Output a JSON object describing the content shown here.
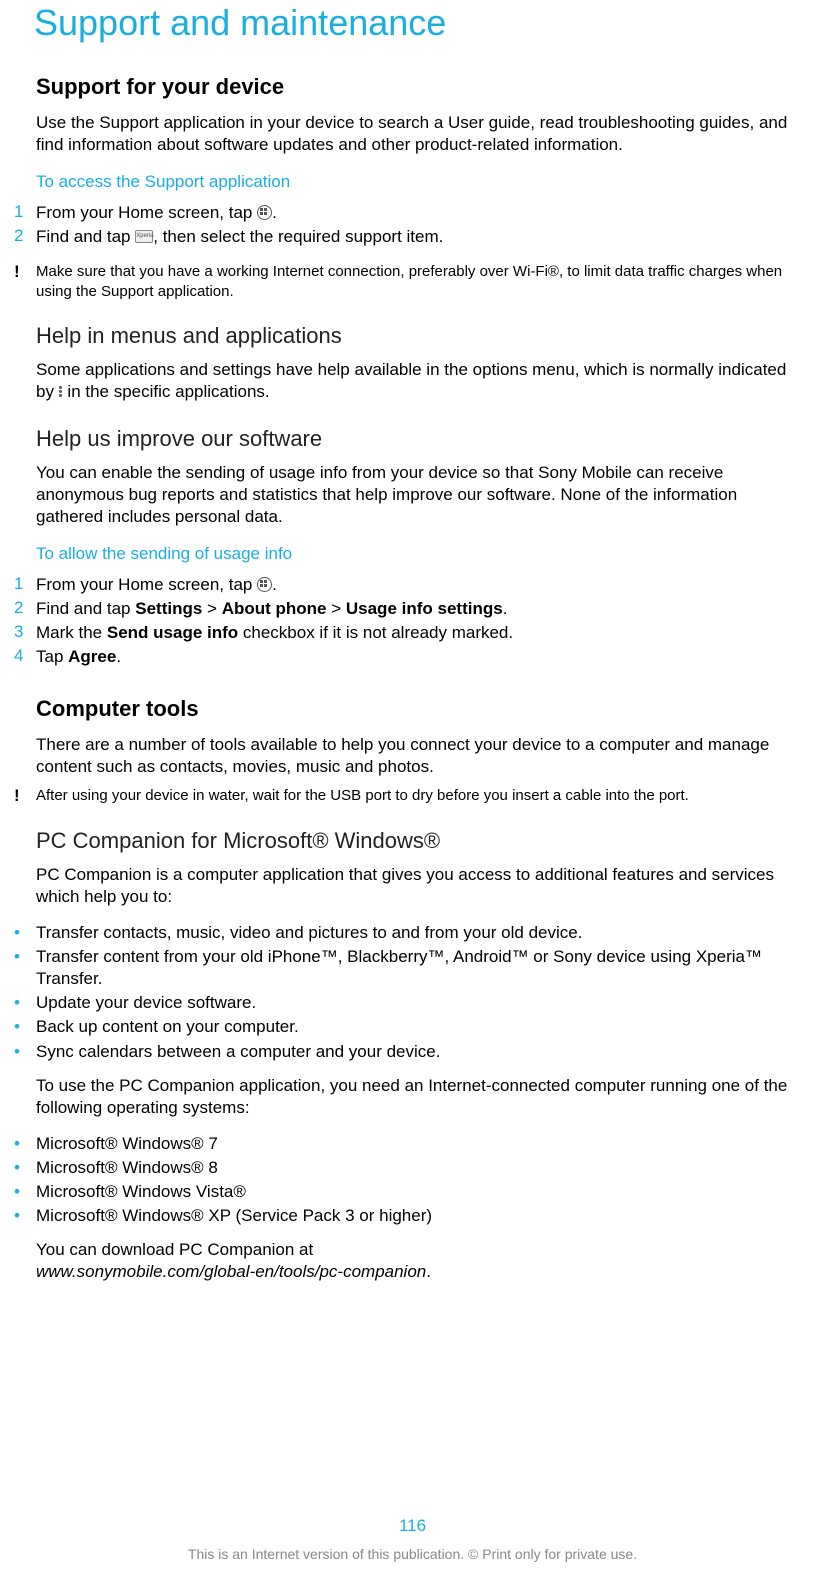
{
  "page_title": "Support and maintenance",
  "support_device": {
    "heading": "Support for your device",
    "body": "Use the Support application in your device to search a User guide, read troubleshooting guides, and find information about software updates and other product-related information.",
    "sub_cyan": "To access the Support application",
    "step1_pre": "From your Home screen, tap ",
    "step1_post": ".",
    "step2_pre": "Find and tap ",
    "step2_post": ", then select the required support item.",
    "note": "Make sure that you have a working Internet connection, preferably over Wi-Fi®, to limit data traffic charges when using the Support application."
  },
  "help_menus": {
    "heading": "Help in menus and applications",
    "body_pre": "Some applications and settings have help available in the options menu, which is normally indicated by ",
    "body_post": " in the specific applications."
  },
  "help_improve": {
    "heading": "Help us improve our software",
    "body": "You can enable the sending of usage info from your device so that Sony Mobile can receive anonymous bug reports and statistics that help improve our software. None of the information gathered includes personal data.",
    "sub_cyan": "To allow the sending of usage info",
    "step1_pre": "From your Home screen, tap ",
    "step1_post": ".",
    "step2_pre": "Find and tap ",
    "step2_b1": "Settings",
    "step2_gt1": " > ",
    "step2_b2": "About phone",
    "step2_gt2": " > ",
    "step2_b3": "Usage info settings",
    "step2_post": ".",
    "step3_pre": "Mark the ",
    "step3_b": "Send usage info",
    "step3_post": " checkbox if it is not already marked.",
    "step4_pre": "Tap ",
    "step4_b": "Agree",
    "step4_post": "."
  },
  "computer_tools": {
    "heading": "Computer tools",
    "body": "There are a number of tools available to help you connect your device to a computer and manage content such as contacts, movies, music and photos.",
    "note": "After using your device in water, wait for the USB port to dry before you insert a cable into the port."
  },
  "pc_companion": {
    "heading": "PC Companion for Microsoft® Windows®",
    "body": "PC Companion is a computer application that gives you access to additional features and services which help you to:",
    "bullets1": [
      "Transfer contacts, music, video and pictures to and from your old device.",
      "Transfer content from your old iPhone™, Blackberry™, Android™ or Sony device using Xperia™ Transfer.",
      "Update your device software.",
      "Back up content on your computer.",
      "Sync calendars between a computer and your device."
    ],
    "mid_text": "To use the PC Companion application, you need an Internet-connected computer running one of the following operating systems:",
    "bullets2": [
      "Microsoft® Windows® 7",
      "Microsoft® Windows® 8",
      "Microsoft® Windows Vista®",
      "Microsoft® Windows® XP (Service Pack 3 or higher)"
    ],
    "download_pre": "You can download PC Companion at",
    "download_url": "www.sonymobile.com/global-en/tools/pc-companion",
    "download_post": "."
  },
  "footer": {
    "page_num": "116",
    "note": "This is an Internet version of this publication. © Print only for private use."
  },
  "nums": {
    "n1": "1",
    "n2": "2",
    "n3": "3",
    "n4": "4"
  },
  "bullet_char": "•",
  "note_char": "!",
  "icon_card_label": "Xperia"
}
